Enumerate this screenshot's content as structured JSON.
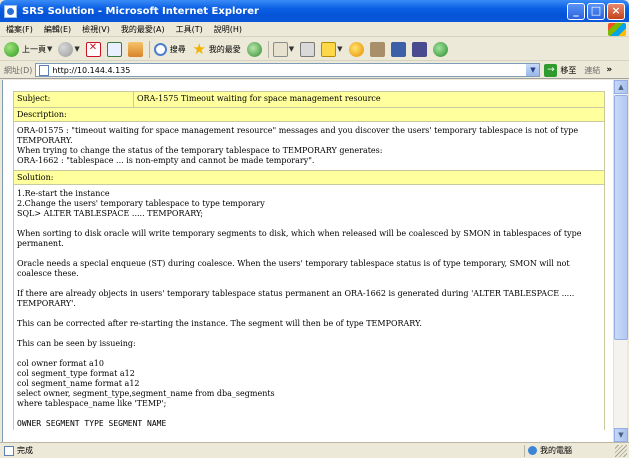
{
  "window": {
    "title": "SRS Solution - Microsoft Internet Explorer",
    "controls": {
      "minimize": "_",
      "maximize": "□",
      "close": "×"
    }
  },
  "menu": [
    "檔案(F)",
    "編輯(E)",
    "檢視(V)",
    "我的最愛(A)",
    "工具(T)",
    "說明(H)"
  ],
  "toolbar": {
    "back_label": "上一頁",
    "search_label": "搜尋",
    "favorites_label": "我的最愛",
    "icons": [
      "back-icon",
      "forward-icon",
      "stop-icon",
      "refresh-icon",
      "home-icon",
      "search-icon",
      "favorites-icon",
      "history-icon",
      "mail-icon",
      "print-icon",
      "edit-icon",
      "messenger-icon",
      "research-icon",
      "translate-icon",
      "media-icon",
      "msn-icon"
    ]
  },
  "address": {
    "label": "網址(D)",
    "url": "http://10.144.4.135",
    "go_label": "移至",
    "links_label": "連結"
  },
  "document": {
    "subject_key": "Subject:",
    "subject_value": "ORA-1575 Timeout waiting for space management resource",
    "description_label": "Description:",
    "description_lines": [
      "ORA-01575 : \"timeout waiting for space management resource\" messages and you discover the users' temporary tablespace is not of type TEMPORARY.",
      "When trying to change the status of the temporary tablespace to TEMPORARY generates:",
      "ORA-1662 : \"tablespace ... is non-empty and cannot be made temporary\"."
    ],
    "solution_label": "Solution:",
    "solution_steps": [
      "1.Re-start the instance",
      "2.Change the users' temporary tablespace to type temporary"
    ],
    "sql_line": "SQL> ALTER TABLESPACE ..... TEMPORARY;",
    "paragraphs": [
      "When sorting to disk oracle will write temporary segments to disk, which when released will be coalesced by SMON in tablespaces of type permanent.",
      "Oracle needs a special enqueue (ST) during coalesce. When the users' temporary tablespace status is of type temporary, SMON will not coalesce these.",
      "If there are already objects in users' temporary tablespace status permanent an ORA-1662 is generated during 'ALTER TABLESPACE ..... TEMPORARY'.",
      "This can be corrected after re-starting the instance. The segment will then be of type TEMPORARY.",
      "This can be seen by issueing:"
    ],
    "code_lines": [
      "col owner format a10",
      "col segment_type format a12",
      "col segment_name format a12",
      "select owner, segment_type,segment_name from dba_segments",
      "where tablespace_name like 'TEMP';"
    ],
    "cut_line": "OWNER SEGMENT_TYPE SEGMENT_NAME"
  },
  "status": {
    "text": "完成",
    "zone": "我的電腦"
  }
}
